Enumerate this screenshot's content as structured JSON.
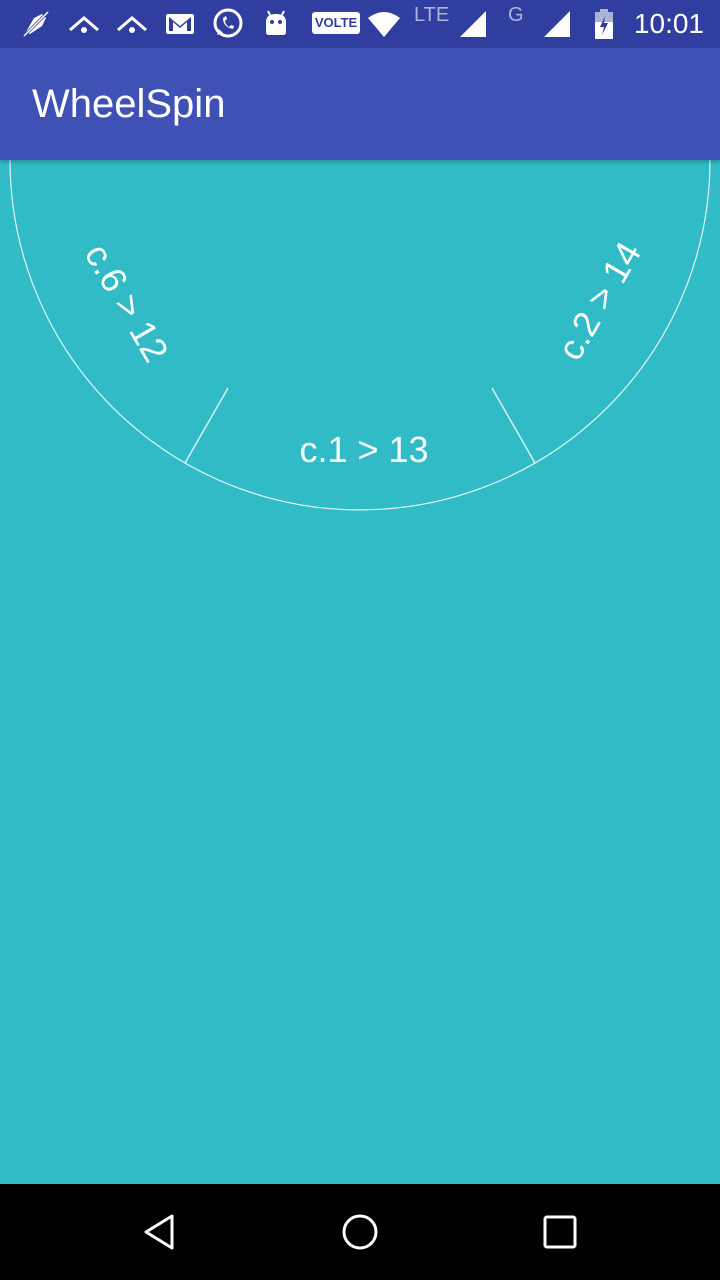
{
  "status_bar": {
    "time": "10:01",
    "volte": "VOLTE",
    "lte": "LTE",
    "g": "G",
    "icons": [
      "silent-icon",
      "signal-hat-icon",
      "signal-hat-icon",
      "gmail-icon",
      "whatsapp-icon",
      "android-icon",
      "volte-icon",
      "wifi-icon",
      "lte-signal-icon",
      "g-signal-icon",
      "battery-charging-icon"
    ]
  },
  "app_bar": {
    "title": "WheelSpin"
  },
  "wheel": {
    "segments": [
      {
        "label": "c.6 > 12"
      },
      {
        "label": "c.1 > 13"
      },
      {
        "label": "c.2 > 14"
      }
    ]
  },
  "nav_bar": {
    "icons": [
      "back-icon",
      "home-icon",
      "recents-icon"
    ]
  },
  "colors": {
    "status_bar": "#303F9F",
    "app_bar": "#3F51B5",
    "background": "#31BBC7",
    "nav_bar": "#000000"
  }
}
